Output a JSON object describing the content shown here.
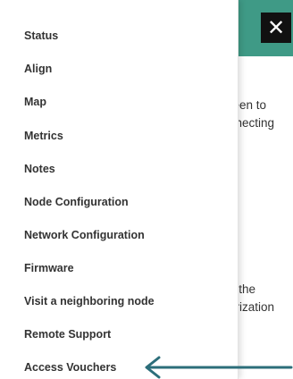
{
  "header": {
    "close_icon": "close-icon",
    "close_glyph": "✕",
    "accent_color": "#3f9a86"
  },
  "background_text": {
    "line1": "reen to",
    "line2": "nnecting",
    "line3": "n the",
    "line4": "orization"
  },
  "menu": {
    "items": [
      {
        "label": "Status"
      },
      {
        "label": "Align"
      },
      {
        "label": "Map"
      },
      {
        "label": "Metrics"
      },
      {
        "label": "Notes"
      },
      {
        "label": "Node Configuration"
      },
      {
        "label": "Network Configuration"
      },
      {
        "label": "Firmware"
      },
      {
        "label": "Visit a neighboring node"
      },
      {
        "label": "Remote Support"
      },
      {
        "label": "Access Vouchers"
      }
    ]
  },
  "annotation": {
    "arrow_icon": "arrow-left-icon",
    "arrow_color": "#2c6e7a"
  }
}
